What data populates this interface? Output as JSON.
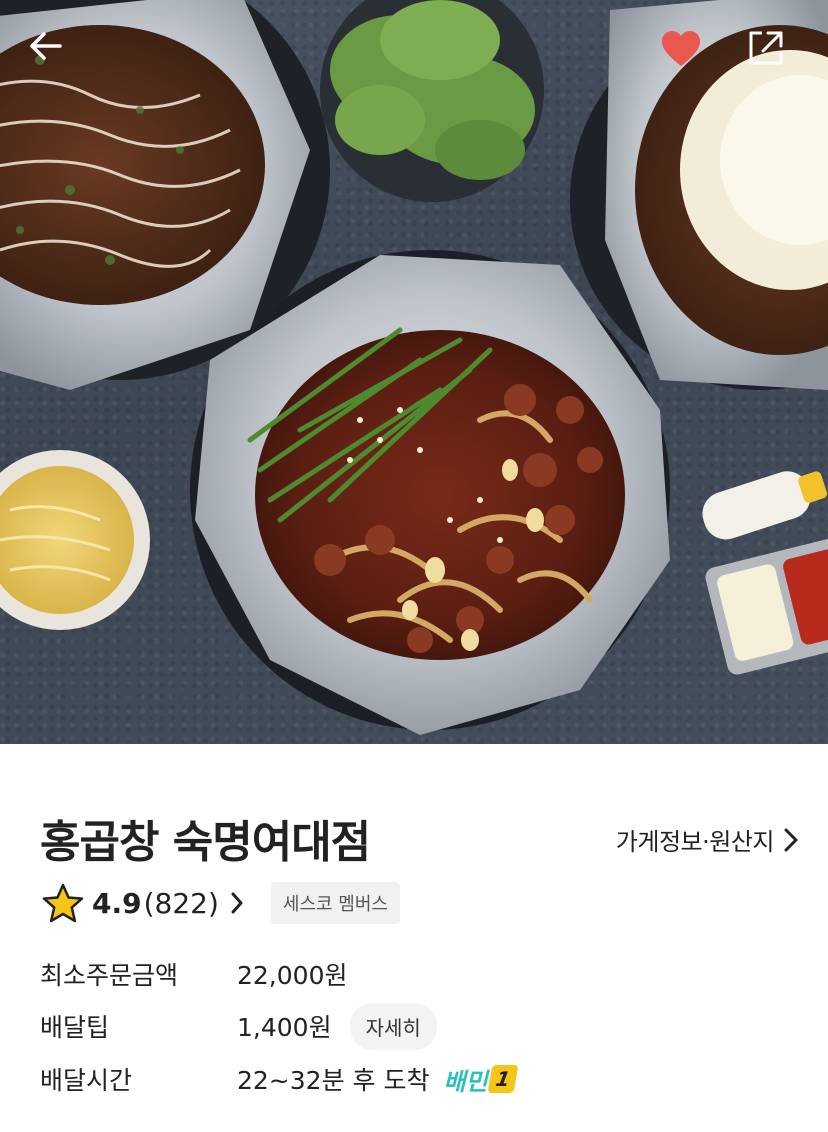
{
  "hero": {
    "back_icon": "arrow-left-icon",
    "favorite_icon": "heart-icon",
    "favorite_color": "#e8584f",
    "share_icon": "share-icon"
  },
  "store": {
    "name": "홍곱창 숙명여대점",
    "info_link": "가게정보·원산지",
    "rating": "4.9",
    "review_count": "(822)",
    "member_badge": "세스코 멤버스"
  },
  "details": {
    "min_order_label": "최소주문금액",
    "min_order_value": "22,000원",
    "delivery_tip_label": "배달팁",
    "delivery_tip_value": "1,400원",
    "delivery_tip_button": "자세히",
    "delivery_time_label": "배달시간",
    "delivery_time_value": "22~32분 후 도착",
    "baemin_badge": "배민",
    "baemin_badge_num": "1"
  },
  "colors": {
    "star": "#f5c518",
    "baemin_accent": "#2ac1bc"
  }
}
